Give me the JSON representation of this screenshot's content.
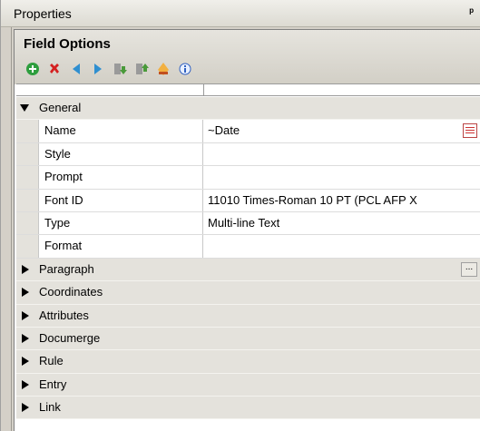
{
  "panel": {
    "title": "Properties",
    "pin_glyph": "ᵖ"
  },
  "field_options": {
    "title": "Field Options",
    "toolbar": [
      {
        "icon": "add-icon",
        "color": "#2e9e3e"
      },
      {
        "icon": "delete-icon",
        "color": "#d42020"
      },
      {
        "icon": "move-left-icon",
        "color": "#2f8fd0"
      },
      {
        "icon": "move-right-icon",
        "color": "#2f8fd0"
      },
      {
        "icon": "move-down-icon",
        "color": "#4a9a3a"
      },
      {
        "icon": "move-up-icon",
        "color": "#4a9a3a"
      },
      {
        "icon": "paint-icon",
        "color": "#c05020"
      },
      {
        "icon": "info-icon",
        "color": "#3060c0"
      }
    ]
  },
  "grid": {
    "general": {
      "label": "General",
      "expanded": true,
      "properties": [
        {
          "name": "Name",
          "value": "~Date",
          "has_button": true
        },
        {
          "name": "Style",
          "value": ""
        },
        {
          "name": "Prompt",
          "value": ""
        },
        {
          "name": "Font ID",
          "value": "11010 Times-Roman 10 PT (PCL AFP X"
        },
        {
          "name": "Type",
          "value": "Multi-line Text"
        },
        {
          "name": "Format",
          "value": ""
        }
      ]
    },
    "categories": [
      {
        "label": "Paragraph",
        "has_ellipsis": true,
        "ellipsis": "..."
      },
      {
        "label": "Coordinates"
      },
      {
        "label": "Attributes"
      },
      {
        "label": "Documerge"
      },
      {
        "label": "Rule"
      },
      {
        "label": "Entry"
      },
      {
        "label": "Link"
      }
    ]
  }
}
